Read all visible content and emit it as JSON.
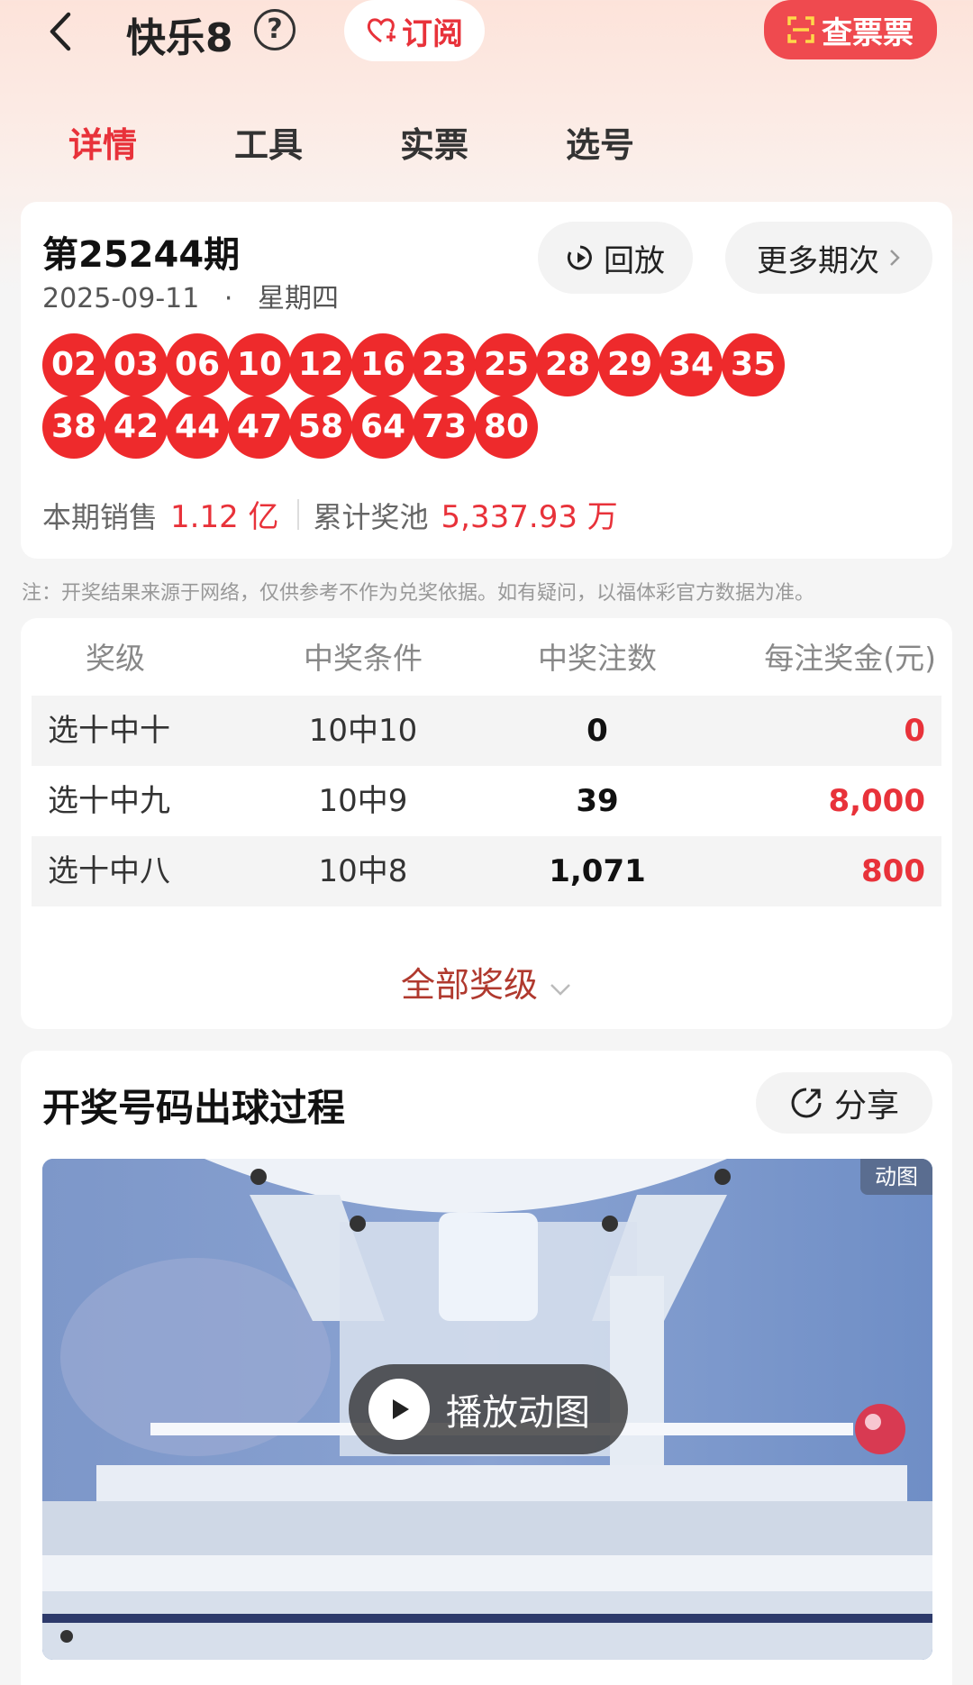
{
  "header": {
    "title": "快乐8",
    "help_glyph": "?",
    "subscribe_label": "订阅",
    "check_ticket_label": "查票票"
  },
  "tabs": [
    {
      "label": "详情",
      "active": true
    },
    {
      "label": "工具",
      "active": false
    },
    {
      "label": "实票",
      "active": false
    },
    {
      "label": "选号",
      "active": false
    }
  ],
  "issue": {
    "title": "第25244期",
    "date": "2025-09-11",
    "dot": "·",
    "weekday": "星期四",
    "replay_label": "回放",
    "more_label": "更多期次",
    "numbers": [
      "02",
      "03",
      "06",
      "10",
      "12",
      "16",
      "23",
      "25",
      "28",
      "29",
      "34",
      "35",
      "38",
      "42",
      "44",
      "47",
      "58",
      "64",
      "73",
      "80"
    ],
    "sales_label": "本期销售",
    "sales_value": "1.12 亿",
    "pool_label": "累计奖池",
    "pool_value": "5,337.93 万"
  },
  "note": "注：开奖结果来源于网络，仅供参考不作为兑奖依据。如有疑问，以福体彩官方数据为准。",
  "prize_table": {
    "headers": [
      "奖级",
      "中奖条件",
      "中奖注数",
      "每注奖金(元)"
    ],
    "rows": [
      [
        "选十中十",
        "10中10",
        "0",
        "0"
      ],
      [
        "选十中九",
        "10中9",
        "39",
        "8,000"
      ],
      [
        "选十中八",
        "10中8",
        "1,071",
        "800"
      ]
    ],
    "all_levels_label": "全部奖级"
  },
  "draw_process": {
    "title": "开奖号码出球过程",
    "share_label": "分享",
    "gif_badge": "动图",
    "play_label": "播放动图"
  },
  "colors": {
    "accent": "#e8323a",
    "ball": "#ee2a2c"
  }
}
